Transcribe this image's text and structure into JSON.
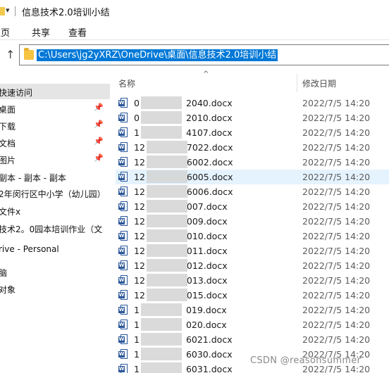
{
  "window": {
    "title": "信息技术2.0培训小结",
    "title_chevron": "▾"
  },
  "ribbon": {
    "tabs": [
      "主页",
      "共享",
      "查看"
    ]
  },
  "address": {
    "path": "C:\\Users\\jg2yXRZ\\OneDrive\\桌面\\信息技术2.0培训小结",
    "up_symbol": "↑"
  },
  "nav": {
    "items": [
      {
        "label": "快速访问",
        "pinned": false,
        "selected": true
      },
      {
        "label": "桌面",
        "pinned": true
      },
      {
        "label": "下载",
        "pinned": true
      },
      {
        "label": "文档",
        "pinned": true
      },
      {
        "label": "图片",
        "pinned": true
      },
      {
        "label": "副本 - 副本 - 副本",
        "pinned": false
      },
      {
        "label": "2年闵行区中小学（幼儿园）",
        "pinned": false
      },
      {
        "label": "文件x",
        "pinned": false
      },
      {
        "label": "技术2。0园本培训作业（文",
        "pinned": false
      },
      {
        "label": "rive - Personal",
        "pinned": false
      },
      {
        "label": "脑",
        "pinned": false
      },
      {
        "label": "对象",
        "pinned": false
      }
    ],
    "pin_symbol": "📌"
  },
  "list": {
    "col_name": "名称",
    "col_date": "修改日期",
    "sort_symbol": "^",
    "hover_index": 5,
    "files": [
      {
        "prefix": "0",
        "suffix": "2040.docx",
        "date": "2022/7/5 14:20"
      },
      {
        "prefix": "0",
        "suffix": "2010.docx",
        "date": "2022/7/5 14:20"
      },
      {
        "prefix": "1",
        "suffix": "4107.docx",
        "date": "2022/7/5 14:20"
      },
      {
        "prefix": "12",
        "suffix": "7022.docx",
        "date": "2022/7/5 14:20"
      },
      {
        "prefix": "12",
        "suffix": "6002.docx",
        "date": "2022/7/5 14:20"
      },
      {
        "prefix": "12",
        "suffix": "6005.docx",
        "date": "2022/7/5 14:20"
      },
      {
        "prefix": "12",
        "suffix": "6006.docx",
        "date": "2022/7/5 14:20"
      },
      {
        "prefix": "12",
        "suffix": "007.docx",
        "date": "2022/7/5 14:20"
      },
      {
        "prefix": "12",
        "suffix": "009.docx",
        "date": "2022/7/5 14:20"
      },
      {
        "prefix": "12",
        "suffix": "010.docx",
        "date": "2022/7/5 14:20"
      },
      {
        "prefix": "12",
        "suffix": "011.docx",
        "date": "2022/7/5 14:20"
      },
      {
        "prefix": "12",
        "suffix": "012.docx",
        "date": "2022/7/5 14:20"
      },
      {
        "prefix": "12",
        "suffix": "013.docx",
        "date": "2022/7/5 14:20"
      },
      {
        "prefix": "12",
        "suffix": "015.docx",
        "date": "2022/7/5 14:20"
      },
      {
        "prefix": "1",
        "suffix": "019.docx",
        "date": "2022/7/5 14:20"
      },
      {
        "prefix": "1",
        "suffix": "020.docx",
        "date": "2022/7/5 14:20"
      },
      {
        "prefix": "1",
        "suffix": "6021.docx",
        "date": "2022/7/5 14:20"
      },
      {
        "prefix": "1",
        "suffix": "6030.docx",
        "date": "2022/7/5 14:20"
      },
      {
        "prefix": "1",
        "suffix": "6031.docx",
        "date": "2022/7/5 14:20"
      }
    ]
  },
  "watermark": "CSDN @reasonsummer"
}
